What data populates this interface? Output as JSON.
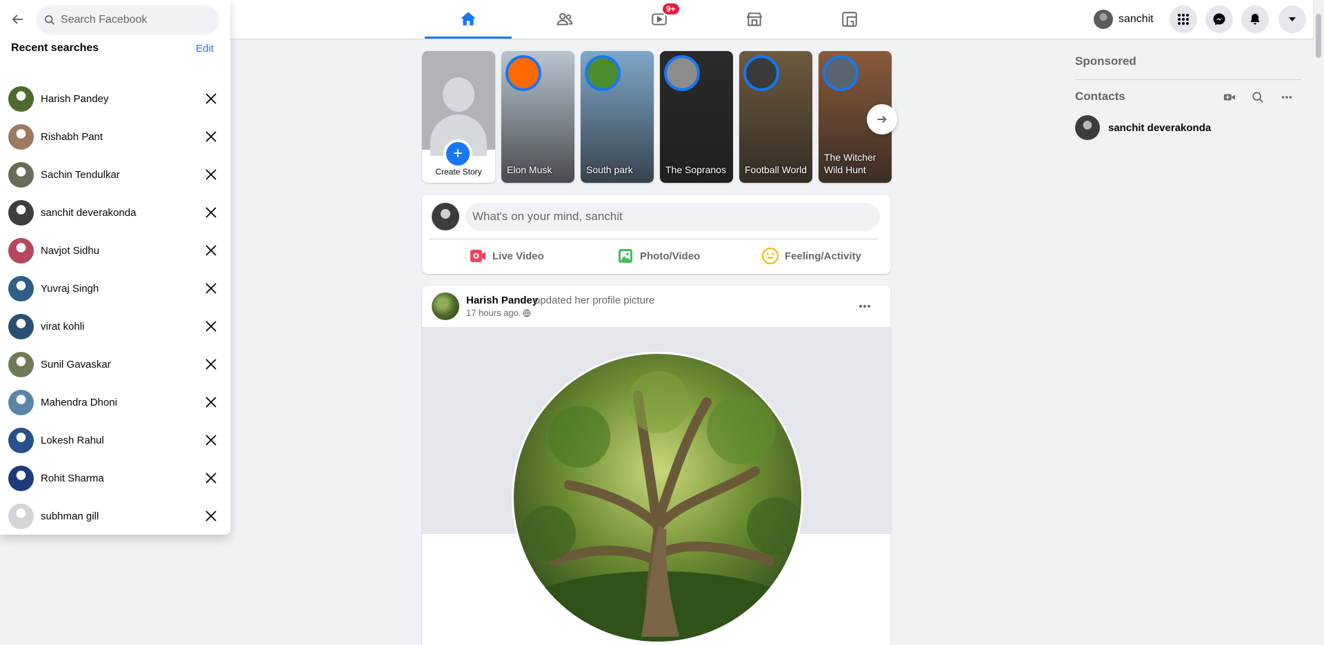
{
  "search": {
    "placeholder": "Search Facebook",
    "recent_title": "Recent searches",
    "edit_label": "Edit",
    "recent": [
      {
        "name": "Harish Pandey",
        "color": "#4f6a2d"
      },
      {
        "name": "Rishabh Pant",
        "color": "#9a7a62"
      },
      {
        "name": "Sachin Tendulkar",
        "color": "#6b6b5a"
      },
      {
        "name": "sanchit deverakonda",
        "color": "#3e3e3e"
      },
      {
        "name": "Navjot Sidhu",
        "color": "#b5485e"
      },
      {
        "name": "Yuvraj Singh",
        "color": "#2f5e86"
      },
      {
        "name": "virat kohli",
        "color": "#2a4f73"
      },
      {
        "name": "Sunil Gavaskar",
        "color": "#6f7a58"
      },
      {
        "name": "Mahendra Dhoni",
        "color": "#5a86a8"
      },
      {
        "name": "Lokesh Rahul",
        "color": "#28508a"
      },
      {
        "name": "Rohit Sharma",
        "color": "#1d3b7a"
      },
      {
        "name": "subhman gill",
        "color": "#d3d5d9"
      }
    ]
  },
  "nav": {
    "tabs": [
      "home",
      "friends",
      "watch",
      "marketplace",
      "gaming"
    ],
    "watch_badge": "9+"
  },
  "header": {
    "user_name": "sanchit"
  },
  "stories": {
    "create_label": "Create Story",
    "items": [
      {
        "label": "Elon Musk",
        "bg": "#b9c4cf",
        "avatar": "#ff6a00"
      },
      {
        "label": "South park",
        "bg": "#7ea7c9",
        "avatar": "#4a8e2f"
      },
      {
        "label": "The Sopranos",
        "bg": "#2a2a2a",
        "avatar": "#8c8c8c"
      },
      {
        "label": "Football World",
        "bg": "#6e5a3e",
        "avatar": "#3a3a3a"
      },
      {
        "label": "The Witcher Wild Hunt",
        "bg": "#8a5a3a",
        "avatar": "#5a6470"
      }
    ]
  },
  "composer": {
    "placeholder": "What's on your mind, sanchit",
    "actions": [
      "Live Video",
      "Photo/Video",
      "Feeling/Activity"
    ]
  },
  "post": {
    "author": "Harish Pandey",
    "action": "updated her profile picture",
    "time": "17 hours ago."
  },
  "sidebar_right": {
    "sponsored": "Sponsored",
    "contacts_title": "Contacts",
    "contacts": [
      "sanchit deverakonda"
    ]
  },
  "colors": {
    "accent": "#1877f2",
    "badge": "#e41e3f",
    "live": "#f3425f",
    "photo": "#45bd62",
    "feeling": "#f7b928"
  }
}
